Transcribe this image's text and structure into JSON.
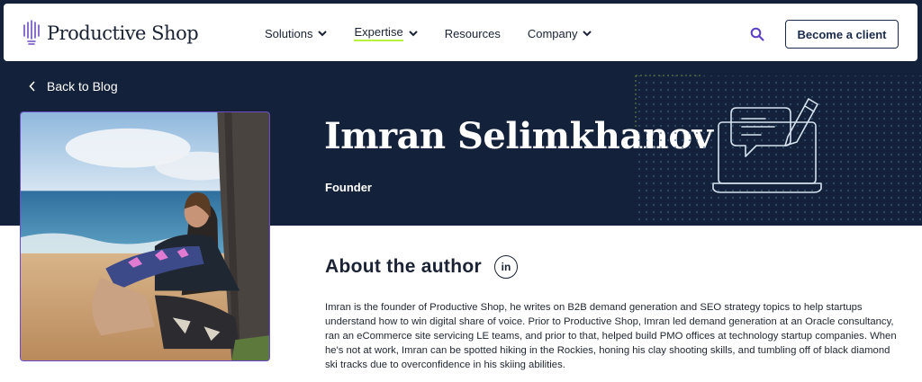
{
  "brand": {
    "name": "Productive Shop",
    "icon": "lightbulb-icon"
  },
  "nav": {
    "items": [
      {
        "label": "Solutions",
        "has_dropdown": true
      },
      {
        "label": "Expertise",
        "has_dropdown": true,
        "active": true
      },
      {
        "label": "Resources",
        "has_dropdown": false
      },
      {
        "label": "Company",
        "has_dropdown": true
      }
    ],
    "search_icon": "search-icon",
    "cta_label": "Become a client"
  },
  "back_link": {
    "label": "Back to Blog",
    "icon": "chevron-left-icon"
  },
  "author": {
    "name": "Imran Selimkhanov",
    "role": "Founder",
    "photo": "author-photo"
  },
  "about": {
    "title": "About the author",
    "linkedin_label": "in",
    "bio": "Imran is the founder of Productive Shop, he writes on B2B demand generation and SEO strategy topics to help startups understand how to win digital share of voice. Prior to Productive Shop, Imran led demand generation at an Oracle consultancy, ran an eCommerce site servicing LE teams, and prior to that, helped build PMO offices at technology startup companies. When he's not at work, Imran can be spotted hiking in the Rockies, honing his clay shooting skills, and tumbling off of black diamond ski tracks due to overconfidence in his skiing abilities."
  },
  "colors": {
    "hero_bg": "#13223a",
    "accent_underline": "#b8f23c",
    "search_purple": "#5b3fc4",
    "cta_border": "#1a2b4a"
  }
}
